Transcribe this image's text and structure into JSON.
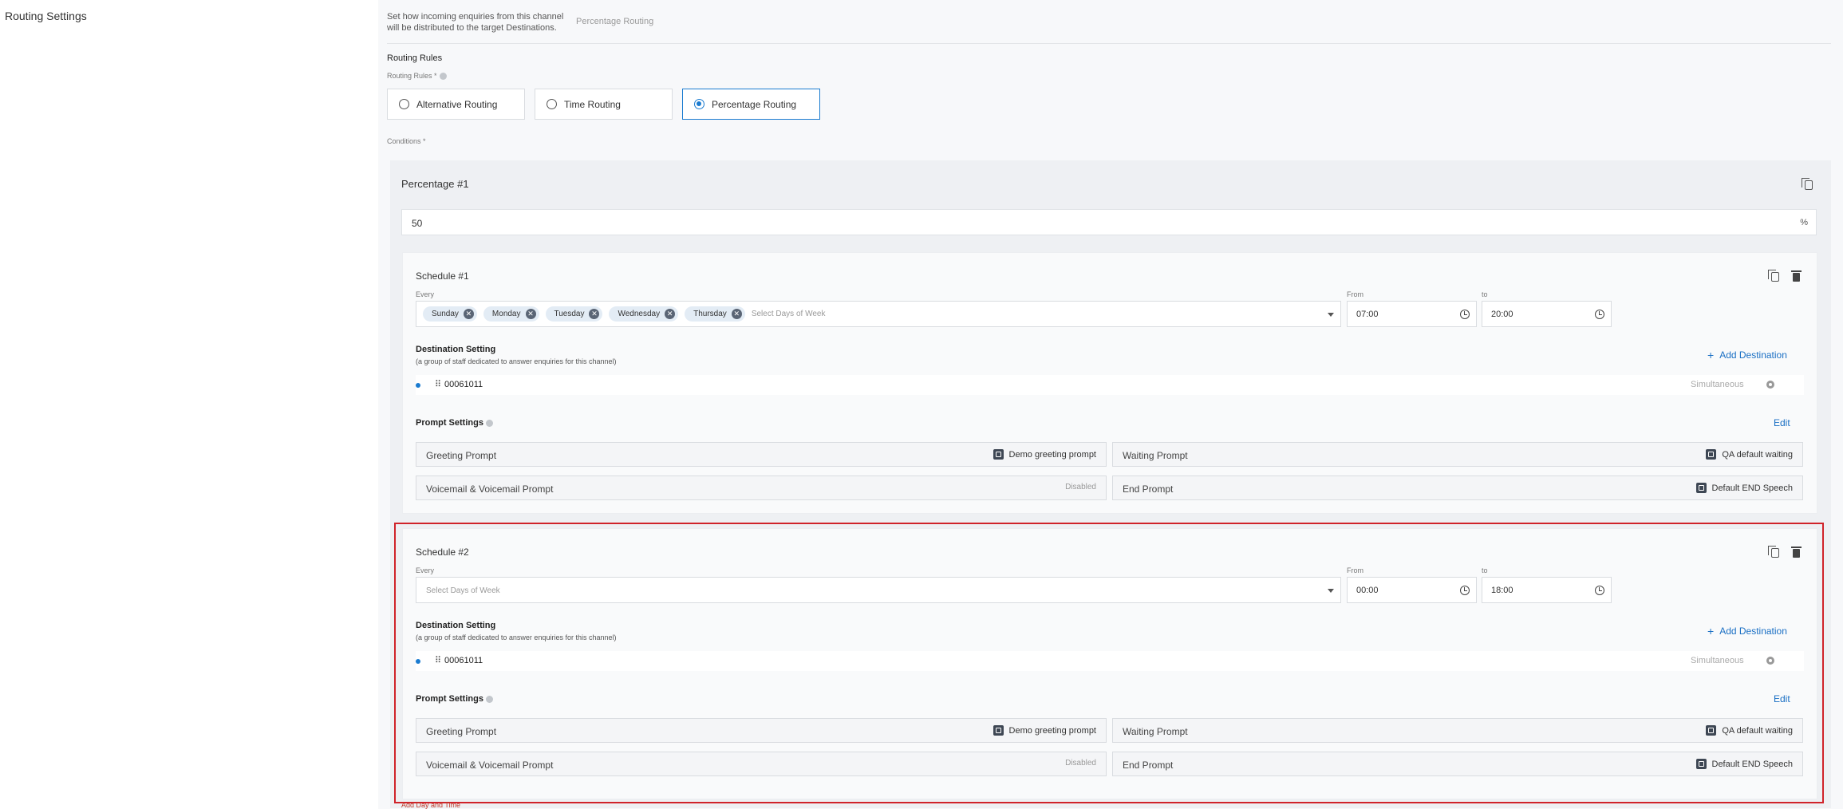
{
  "left": {
    "title": "Routing Settings"
  },
  "intro": {
    "description": "Set how incoming enquiries from this channel will be distributed to the target Destinations.",
    "current_value": "Percentage Routing"
  },
  "routing_rules": {
    "section_title": "Routing Rules",
    "field_label": "Routing Rules *",
    "options": [
      "Alternative Routing",
      "Time Routing",
      "Percentage Routing"
    ],
    "selected": "Percentage Routing"
  },
  "conditions": {
    "label": "Conditions *",
    "percentage": {
      "title": "Percentage #1",
      "value": "50",
      "unit": "%",
      "schedules": [
        {
          "title": "Schedule #1",
          "every_label": "Every",
          "days": [
            "Sunday",
            "Monday",
            "Tuesday",
            "Wednesday",
            "Thursday"
          ],
          "days_placeholder": "Select Days of Week",
          "from_label": "From",
          "from": "07:00",
          "to_label": "to",
          "to": "20:00",
          "destination_title": "Destination Setting",
          "destination_sub": "(a group of staff dedicated to answer enquiries for this channel)",
          "add_destination": "Add Destination",
          "destination": "00061011",
          "destination_mode": "Simultaneous",
          "prompt_title": "Prompt Settings",
          "edit": "Edit",
          "prompts": {
            "greeting_label": "Greeting Prompt",
            "greeting_value": "Demo greeting prompt",
            "waiting_label": "Waiting Prompt",
            "waiting_value": "QA default waiting",
            "voicemail_label": "Voicemail & Voicemail Prompt",
            "voicemail_value": "Disabled",
            "end_label": "End Prompt",
            "end_value": "Default END Speech"
          }
        },
        {
          "title": "Schedule #2",
          "every_label": "Every",
          "days": [],
          "days_placeholder": "Select Days of Week",
          "from_label": "From",
          "from": "00:00",
          "to_label": "to",
          "to": "18:00",
          "destination_title": "Destination Setting",
          "destination_sub": "(a group of staff dedicated to answer enquiries for this channel)",
          "add_destination": "Add Destination",
          "destination": "00061011",
          "destination_mode": "Simultaneous",
          "prompt_title": "Prompt Settings",
          "edit": "Edit",
          "prompts": {
            "greeting_label": "Greeting Prompt",
            "greeting_value": "Demo greeting prompt",
            "waiting_label": "Waiting Prompt",
            "waiting_value": "QA default waiting",
            "voicemail_label": "Voicemail & Voicemail Prompt",
            "voicemail_value": "Disabled",
            "end_label": "End Prompt",
            "end_value": "Default END Speech"
          }
        }
      ],
      "add_day_time": "Add Day and Time"
    }
  },
  "colors": {
    "accent": "#1a7bd0",
    "highlight": "#d0232a"
  }
}
